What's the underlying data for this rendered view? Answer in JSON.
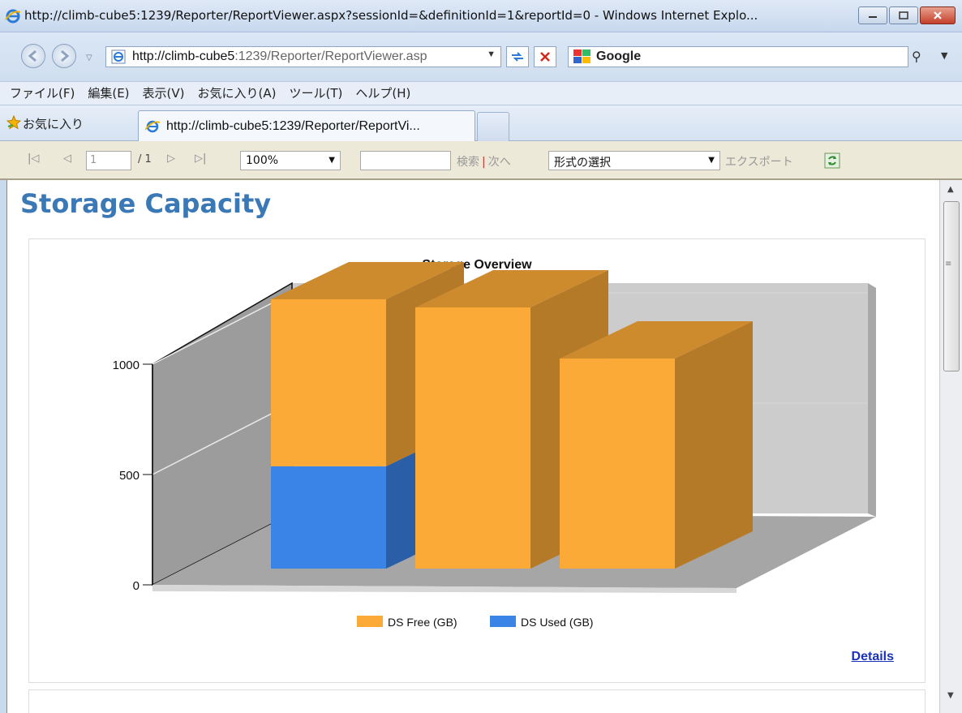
{
  "window": {
    "title": "http://climb-cube5:1239/Reporter/ReportViewer.aspx?sessionId=&definitionId=1&reportId=0 - Windows Internet Explo..."
  },
  "address": {
    "url_host": "http://climb-cube5",
    "url_rest": ":1239/Reporter/ReportViewer.asp",
    "search_provider": "Google"
  },
  "menu": {
    "items": [
      "ファイル(F)",
      "編集(E)",
      "表示(V)",
      "お気に入り(A)",
      "ツール(T)",
      "ヘルプ(H)"
    ]
  },
  "favorites": {
    "label": "お気に入り",
    "tab_title": "http://climb-cube5:1239/Reporter/ReportVi..."
  },
  "report_toolbar": {
    "page_value": "1",
    "page_total": "/ 1",
    "zoom": "100%",
    "find_label": "検索",
    "find_sep": "|",
    "next_label": "次へ",
    "format_placeholder": "形式の選択",
    "export_label": "エクスポート"
  },
  "report": {
    "title": "Storage Capacity",
    "details_link": "Details"
  },
  "chart_data": {
    "type": "bar",
    "stacked": true,
    "three_d": true,
    "title": "Storage Overview",
    "categories": [
      "",
      "",
      ""
    ],
    "series": [
      {
        "name": "DS Used (GB)",
        "color": "#3a84e8",
        "values": [
          380,
          0,
          0
        ]
      },
      {
        "name": "DS Free (GB)",
        "color": "#fbaa37",
        "values": [
          620,
          970,
          780
        ]
      }
    ],
    "legend_order": [
      "DS Free (GB)",
      "DS Used (GB)"
    ],
    "yticks": [
      0,
      500,
      1000
    ],
    "ylim": [
      0,
      1000
    ],
    "legend_position": "bottom"
  }
}
